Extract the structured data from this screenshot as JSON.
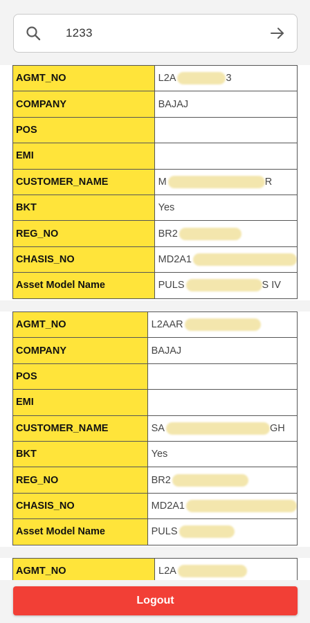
{
  "search": {
    "value": "1233",
    "icon": "search-icon",
    "submit_icon": "arrow-right-icon"
  },
  "records": [
    {
      "rows": [
        {
          "label": "AGMT_NO",
          "value": "L2A",
          "suffix": "3"
        },
        {
          "label": "COMPANY",
          "value": "BAJAJ",
          "suffix": ""
        },
        {
          "label": "POS",
          "value": "",
          "suffix": ""
        },
        {
          "label": "EMI",
          "value": "",
          "suffix": ""
        },
        {
          "label": "CUSTOMER_NAME",
          "value": "M",
          "suffix": "R"
        },
        {
          "label": "BKT",
          "value": "Yes",
          "suffix": ""
        },
        {
          "label": "REG_NO",
          "value": "BR2",
          "suffix": ""
        },
        {
          "label": "CHASIS_NO",
          "value": "MD2A1",
          "suffix": ""
        },
        {
          "label": "Asset Model Name",
          "value": "PULS",
          "suffix": "S IV"
        }
      ]
    },
    {
      "rows": [
        {
          "label": "AGMT_NO",
          "value": "L2AAR",
          "suffix": ""
        },
        {
          "label": "COMPANY",
          "value": "BAJAJ",
          "suffix": ""
        },
        {
          "label": "POS",
          "value": "",
          "suffix": ""
        },
        {
          "label": "EMI",
          "value": "",
          "suffix": ""
        },
        {
          "label": "CUSTOMER_NAME",
          "value": "SA",
          "suffix": "GH"
        },
        {
          "label": "BKT",
          "value": "Yes",
          "suffix": ""
        },
        {
          "label": "REG_NO",
          "value": "BR2",
          "suffix": ""
        },
        {
          "label": "CHASIS_NO",
          "value": "MD2A1",
          "suffix": ""
        },
        {
          "label": "Asset Model Name",
          "value": "PULS",
          "suffix": ""
        }
      ]
    },
    {
      "rows": [
        {
          "label": "AGMT_NO",
          "value": "L2A",
          "suffix": ""
        }
      ]
    }
  ],
  "logout_label": "Logout",
  "colors": {
    "label_bg": "#ffe43a",
    "logout_bg": "#f23f36",
    "page_bg": "#f3f3f3"
  }
}
